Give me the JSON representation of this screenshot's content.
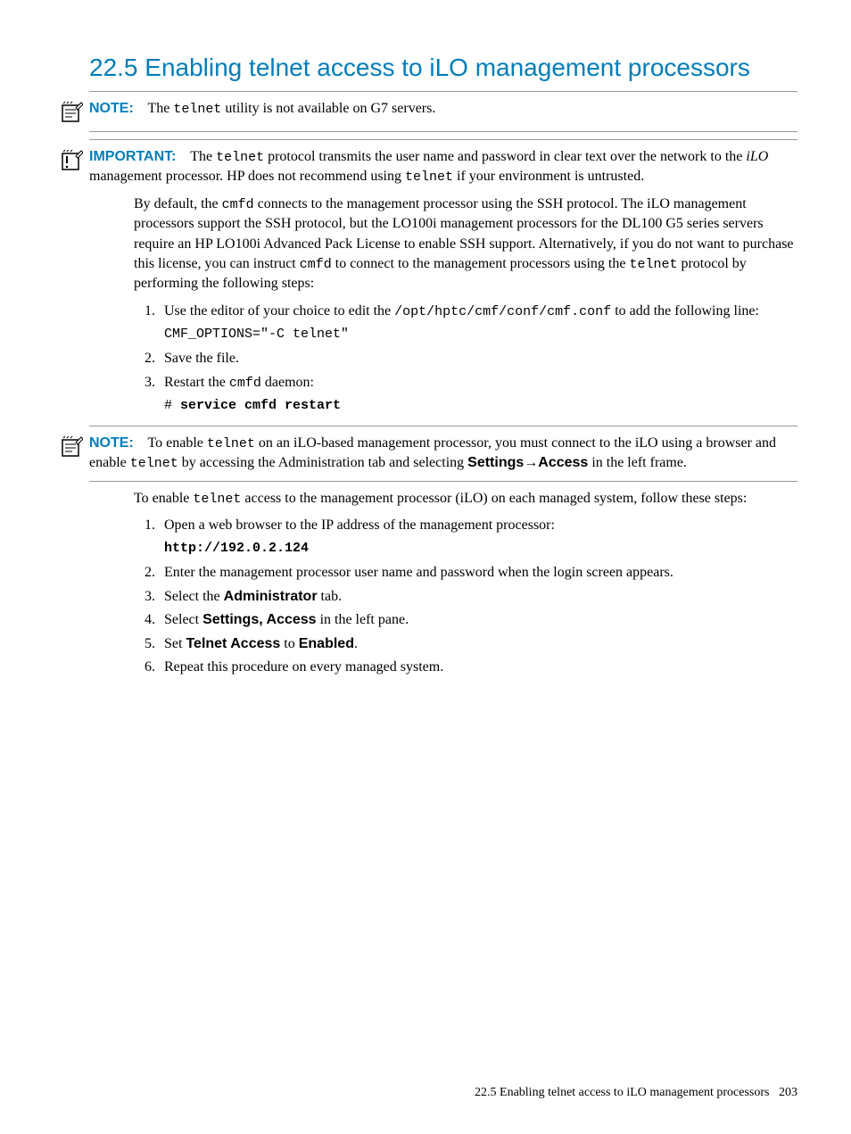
{
  "heading": "22.5 Enabling telnet access to iLO management processors",
  "note1": {
    "label": "NOTE:",
    "text_before": "The ",
    "code1": "telnet",
    "text_after": " utility is not available on G7 servers."
  },
  "important": {
    "label": "IMPORTANT:",
    "t1": "The ",
    "c1": "telnet",
    "t2": " protocol transmits the user name and password in clear text over the network to the ",
    "i1": "iLO",
    "t3": " management processor. HP does not recommend using ",
    "c2": "telnet",
    "t4": " if your environment is untrusted."
  },
  "para1": {
    "t1": "By default, the ",
    "c1": "cmfd",
    "t2": " connects to the management processor using the SSH protocol. The iLO management processors support the SSH protocol, but the LO100i management processors for the DL100 G5 series servers require an HP LO100i Advanced Pack License to enable SSH support. Alternatively, if you do not want to purchase this license, you can instruct ",
    "c2": "cmfd",
    "t3": " to connect to the management processors using the ",
    "c3": "telnet",
    "t4": " protocol by performing the following steps:"
  },
  "steps1": {
    "s1_t1": "Use the editor of your choice to edit the ",
    "s1_c1": "/opt/hptc/cmf/conf/cmf.conf",
    "s1_t2": " to add the following line:",
    "s1_code": "CMF_OPTIONS=\"-C telnet\"",
    "s2": "Save the file.",
    "s3_t1": "Restart the ",
    "s3_c1": "cmfd",
    "s3_t2": " daemon:",
    "s3_code_prefix": "# ",
    "s3_code": "service cmfd restart"
  },
  "note2": {
    "label": "NOTE:",
    "t1": "To enable ",
    "c1": "telnet",
    "t2": " on an iLO-based management processor, you must connect to the iLO using a browser and enable ",
    "c2": "telnet",
    "t3": " by accessing the Administration tab and selecting ",
    "b1": "Settings",
    "arrow": "→",
    "b2": "Access",
    "t4": " in the left frame."
  },
  "para2": {
    "t1": "To enable ",
    "c1": "telnet",
    "t2": " access to the management processor (iLO) on each managed system, follow these steps:"
  },
  "steps2": {
    "s1": "Open a web browser to the IP address of the management processor:",
    "s1_code": "http://192.0.2.124",
    "s2": "Enter the management processor user name and password when the login screen appears.",
    "s3_t1": "Select the ",
    "s3_b1": "Administrator",
    "s3_t2": " tab.",
    "s4_t1": "Select ",
    "s4_b1": "Settings, Access",
    "s4_t2": " in the left pane.",
    "s5_t1": "Set ",
    "s5_b1": "Telnet Access",
    "s5_t2": " to ",
    "s5_b2": "Enabled",
    "s5_t3": ".",
    "s6": "Repeat this procedure on every managed system."
  },
  "footer": {
    "text": "22.5 Enabling telnet access to iLO management processors",
    "page": "203"
  }
}
